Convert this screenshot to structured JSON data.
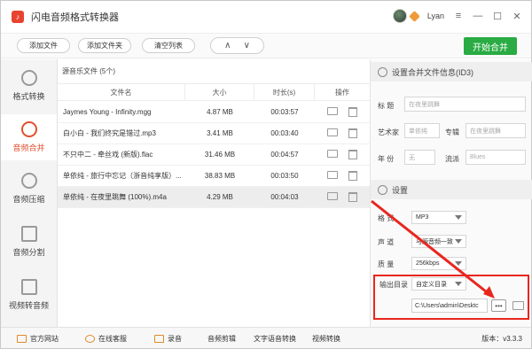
{
  "app": {
    "title": "闪电音频格式转换器",
    "logo_glyph": "♪",
    "username": "Lyan"
  },
  "window_controls": {
    "menu": "≡",
    "minimize": "—",
    "restore": "☐",
    "close": "✕"
  },
  "toolbar": {
    "add_file": "添加文件",
    "add_folder": "添加文件夹",
    "clear_list": "清空列表",
    "up": "∧",
    "down": "∨",
    "start_merge": "开始合并"
  },
  "sidebar": {
    "items": [
      {
        "label": "格式转换"
      },
      {
        "label": "音频合并"
      },
      {
        "label": "音频压缩"
      },
      {
        "label": "音频分割"
      },
      {
        "label": "视频转音频"
      }
    ]
  },
  "list": {
    "title": "源音乐文件 (5个)",
    "columns": [
      "文件名",
      "大小",
      "时长(s)",
      "操作"
    ],
    "rows": [
      {
        "name": "Jaymes Young - Infinity.mgg",
        "size": "4.87 MB",
        "duration": "00:03:57"
      },
      {
        "name": "白小白 - 我们终究是错过.mp3",
        "size": "3.41 MB",
        "duration": "00:03:40"
      },
      {
        "name": "不只中二 - 牵丝戏 (新版).flac",
        "size": "31.46 MB",
        "duration": "00:04:57"
      },
      {
        "name": "单依纯 - 旅行中忘记（浙音纯享版）...",
        "size": "38.83 MB",
        "duration": "00:03:50"
      },
      {
        "name": "单依纯 - 在夜里跳舞 (100%).m4a",
        "size": "4.29 MB",
        "duration": "00:04:03"
      }
    ]
  },
  "id3": {
    "header": "设置合并文件信息(ID3)",
    "title_label": "标 题",
    "title_value": "在夜里跳舞",
    "artist_label": "艺术家",
    "artist_value": "单依纯",
    "album_label": "专辑",
    "album_value": "在夜里跳舞",
    "year_label": "年 份",
    "year_value": "无",
    "genre_label": "流派",
    "genre_value": "Blues"
  },
  "settings": {
    "header": "设置",
    "format_label": "格 式",
    "format_value": "MP3",
    "channel_label": "声 道",
    "channel_value": "与源音频一致",
    "quality_label": "质 量",
    "quality_value": "256kbps",
    "output_label": "输出目录",
    "output_value": "自定义目录",
    "path_value": "C:\\Users\\admin\\Desktc",
    "browse": "•••"
  },
  "statusbar": {
    "website": "官方网站",
    "service": "在线客服",
    "record": "录音",
    "audio_cut": "音频剪辑",
    "tts": "文字语音转换",
    "video_convert": "视频转换",
    "version": "版本：v3.3.3"
  },
  "colors": {
    "accent": "#e24f2f",
    "start": "#2aab43",
    "annotation": "#e8261e"
  }
}
